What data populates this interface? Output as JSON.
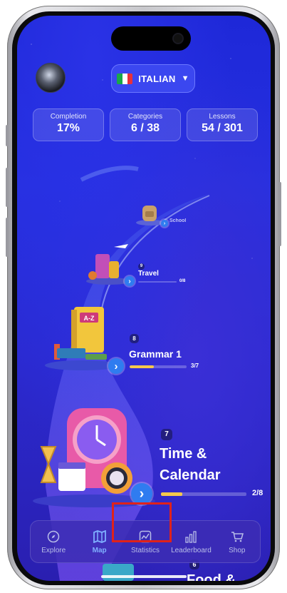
{
  "header": {
    "language_label": "ITALIAN",
    "flag_colors": [
      "#1aa84a",
      "#ffffff",
      "#e8303a"
    ]
  },
  "stats": [
    {
      "label": "Completion",
      "value": "17%"
    },
    {
      "label": "Categories",
      "value": "6 / 38"
    },
    {
      "label": "Lessons",
      "value": "54 / 301"
    }
  ],
  "nodes": [
    {
      "name": "School",
      "number": "",
      "progress_text": "",
      "progress": 0
    },
    {
      "name": "Travel",
      "number": "9",
      "progress_text": "0/8",
      "progress": 0
    },
    {
      "name": "Grammar 1",
      "number": "8",
      "progress_text": "3/7",
      "progress": 0.43
    },
    {
      "name": "Time & Calendar",
      "name_line1": "Time &",
      "name_line2": "Calendar",
      "number": "7",
      "progress_text": "2/8",
      "progress": 0.25
    },
    {
      "name": "Food &",
      "number": "6"
    }
  ],
  "tabbar": [
    {
      "label": "Explore",
      "icon": "compass-icon"
    },
    {
      "label": "Map",
      "icon": "map-icon",
      "active": true
    },
    {
      "label": "Statistics",
      "icon": "statistics-icon"
    },
    {
      "label": "Leaderboard",
      "icon": "leaderboard-icon"
    },
    {
      "label": "Shop",
      "icon": "cart-icon"
    }
  ],
  "colors": {
    "accent": "#2f7cf0",
    "progress": "#f5c84c",
    "highlight": "#e0221a"
  }
}
